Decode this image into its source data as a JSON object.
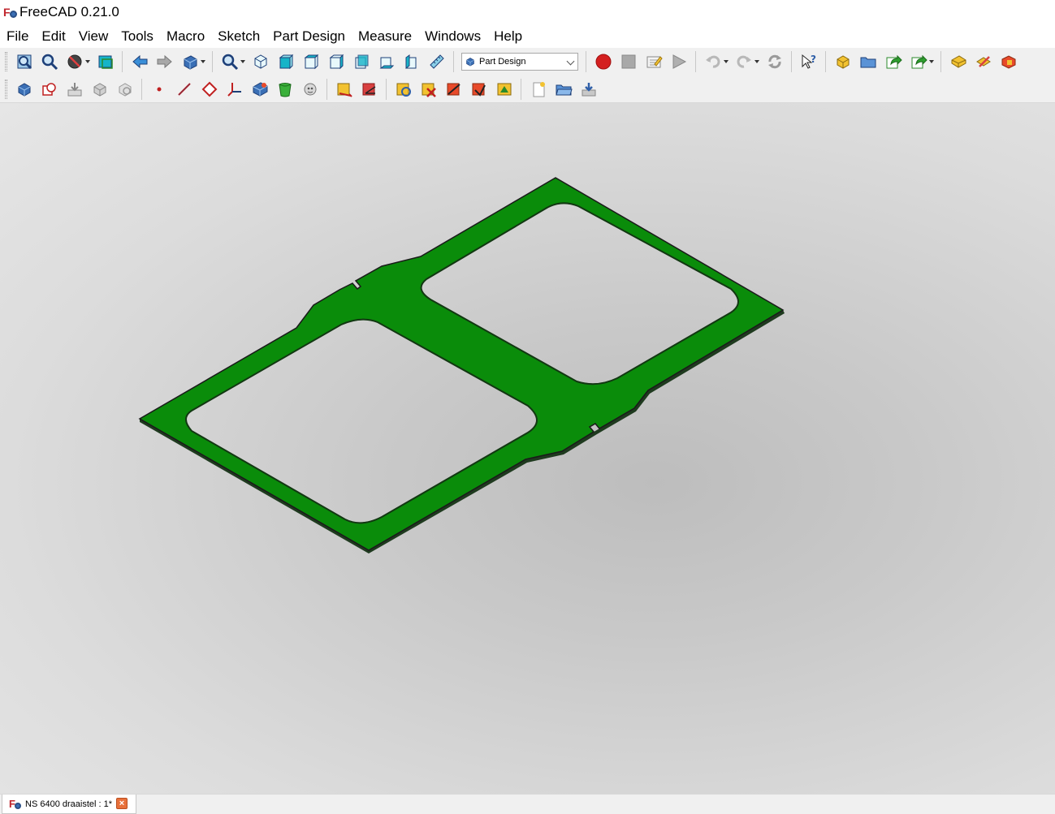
{
  "window": {
    "title": "FreeCAD 0.21.0"
  },
  "menu": [
    "File",
    "Edit",
    "View",
    "Tools",
    "Macro",
    "Sketch",
    "Part Design",
    "Measure",
    "Windows",
    "Help"
  ],
  "workbench_selector": {
    "value": "Part Design"
  },
  "toolbar1": [
    {
      "name": "fit-all-icon",
      "dd": false
    },
    {
      "name": "fit-selection-icon",
      "dd": false
    },
    {
      "name": "draw-style-icon",
      "dd": true
    },
    {
      "name": "bounding-box-icon",
      "dd": false
    },
    {
      "sep": true
    },
    {
      "name": "back-arrow-icon",
      "dd": false
    },
    {
      "name": "forward-arrow-icon",
      "dd": false
    },
    {
      "name": "navigation-cube-icon",
      "dd": true
    },
    {
      "sep": true
    },
    {
      "name": "std-views-icon",
      "dd": true
    },
    {
      "name": "isometric-view-icon",
      "dd": false
    },
    {
      "name": "front-view-icon",
      "dd": false
    },
    {
      "name": "top-view-icon",
      "dd": false
    },
    {
      "name": "right-view-icon",
      "dd": false
    },
    {
      "name": "rear-view-icon",
      "dd": false
    },
    {
      "name": "bottom-view-icon",
      "dd": false
    },
    {
      "name": "left-view-icon",
      "dd": false
    },
    {
      "name": "measure-ruler-icon",
      "dd": false
    }
  ],
  "toolbar1_right": [
    {
      "name": "record-macro-icon",
      "dd": false
    },
    {
      "name": "stop-macro-icon",
      "dd": false
    },
    {
      "name": "edit-macro-icon",
      "dd": false
    },
    {
      "name": "run-macro-icon",
      "dd": false
    },
    {
      "sep": true
    },
    {
      "name": "undo-icon",
      "dd": true
    },
    {
      "name": "redo-icon",
      "dd": true
    },
    {
      "name": "refresh-icon",
      "dd": false
    },
    {
      "sep": true
    },
    {
      "name": "whats-this-icon",
      "dd": false
    },
    {
      "sep": true
    },
    {
      "name": "create-part-icon",
      "dd": false
    },
    {
      "name": "create-group-icon",
      "dd": false
    },
    {
      "name": "create-link-icon",
      "dd": false
    },
    {
      "name": "link-actions-icon",
      "dd": true
    },
    {
      "sep": true
    },
    {
      "name": "create-body-icon",
      "dd": false
    },
    {
      "name": "create-sketch-icon",
      "dd": false
    },
    {
      "name": "validate-sketch-icon",
      "dd": false
    }
  ],
  "toolbar2": [
    {
      "name": "body-icon"
    },
    {
      "name": "clone-icon"
    },
    {
      "name": "shape-binder-icon"
    },
    {
      "name": "subshape-binder-icon"
    },
    {
      "name": "attachment-icon"
    },
    {
      "sep": true
    },
    {
      "name": "datum-point-icon"
    },
    {
      "name": "datum-line-icon"
    },
    {
      "name": "datum-plane-icon"
    },
    {
      "name": "local-cs-icon"
    },
    {
      "name": "pad-icon"
    },
    {
      "name": "revolution-icon"
    },
    {
      "name": "sprocket-icon"
    },
    {
      "sep": true
    },
    {
      "name": "measure-linear-icon"
    },
    {
      "name": "measure-angular-icon"
    },
    {
      "sep": true
    },
    {
      "name": "measure-refresh-icon"
    },
    {
      "name": "measure-clear-icon"
    },
    {
      "name": "measure-toggle-all-icon"
    },
    {
      "name": "measure-toggle-3d-icon"
    },
    {
      "name": "measure-toggle-delta-icon"
    },
    {
      "sep": true
    },
    {
      "name": "new-document-icon"
    },
    {
      "name": "open-document-icon"
    },
    {
      "name": "save-document-icon"
    }
  ],
  "colors": {
    "part_fill": "#0a8c0a",
    "part_edge": "#1a1a1a",
    "record": "#d42020"
  },
  "document_tab": {
    "label": "NS 6400 draaistel : 1*"
  }
}
